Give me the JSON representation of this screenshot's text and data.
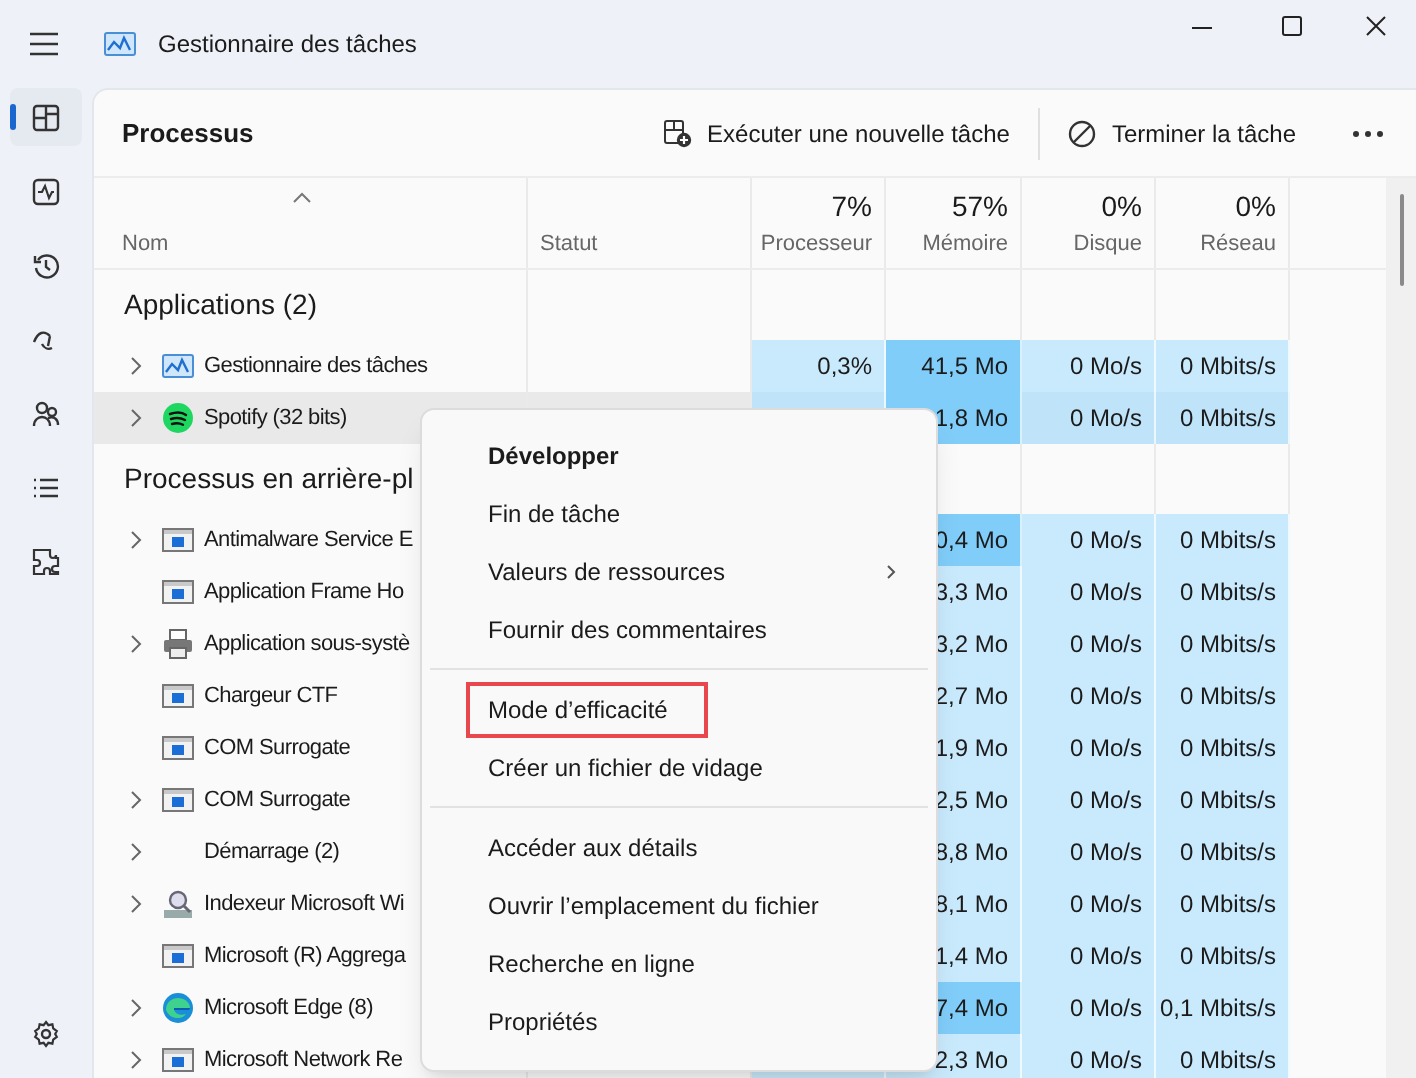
{
  "window": {
    "title": "Gestionnaire des tâches"
  },
  "nav": {
    "items": [
      {
        "selected": true
      },
      {
        "selected": false
      },
      {
        "selected": false
      },
      {
        "selected": false
      },
      {
        "selected": false
      },
      {
        "selected": false
      },
      {
        "selected": false
      }
    ]
  },
  "toolbar": {
    "title": "Processus",
    "actions": [
      {
        "label": "Exécuter une nouvelle tâche"
      },
      {
        "label": "Terminer la tâche"
      }
    ]
  },
  "columns": [
    {
      "label": "Nom",
      "sorted": true
    },
    {
      "label": "Statut",
      "sorted": false
    },
    {
      "label": "Processeur",
      "percent": "7%",
      "sorted": false
    },
    {
      "label": "Mémoire",
      "percent": "57%",
      "sorted": false
    },
    {
      "label": "Disque",
      "percent": "0%",
      "sorted": false
    },
    {
      "label": "Réseau",
      "percent": "0%",
      "sorted": false
    }
  ],
  "groups": [
    {
      "title": "Applications (2)",
      "rows": [
        {
          "name": "Gestionnaire des tâches",
          "kind": "taskmgr",
          "expandable": true,
          "highlighted": false,
          "cells": {
            "cpu": {
              "text": "0,3%",
              "high": false
            },
            "memory": {
              "text": "41,5 Mo",
              "high": true
            },
            "disk": {
              "text": "0 Mo/s",
              "high": false
            },
            "network": {
              "text": "0 Mbits/s",
              "high": false
            }
          }
        },
        {
          "name": "Spotify (32 bits)",
          "kind": "spotify",
          "expandable": true,
          "highlighted": true,
          "cells": {
            "memory": {
              "text": "1,8 Mo",
              "high": true
            },
            "disk": {
              "text": "0 Mo/s",
              "high": false
            },
            "network": {
              "text": "0 Mbits/s",
              "high": false
            }
          }
        }
      ]
    },
    {
      "title": "Processus en arrière-pl",
      "rows": [
        {
          "name": "Antimalware Service E",
          "kind": "app",
          "expandable": true,
          "highlighted": false,
          "cells": {
            "memory": {
              "text": "0,4 Mo",
              "high": true
            },
            "disk": {
              "text": "0 Mo/s",
              "high": false
            },
            "network": {
              "text": "0 Mbits/s",
              "high": false
            }
          }
        },
        {
          "name": "Application Frame Ho",
          "kind": "app",
          "expandable": false,
          "highlighted": false,
          "cells": {
            "memory": {
              "text": "3,3 Mo",
              "high": false
            },
            "disk": {
              "text": "0 Mo/s",
              "high": false
            },
            "network": {
              "text": "0 Mbits/s",
              "high": false
            }
          }
        },
        {
          "name": "Application sous-systè",
          "kind": "printer",
          "expandable": true,
          "highlighted": false,
          "cells": {
            "memory": {
              "text": "3,2 Mo",
              "high": false
            },
            "disk": {
              "text": "0 Mo/s",
              "high": false
            },
            "network": {
              "text": "0 Mbits/s",
              "high": false
            }
          }
        },
        {
          "name": "Chargeur CTF",
          "kind": "app",
          "expandable": false,
          "highlighted": false,
          "cells": {
            "memory": {
              "text": "2,7 Mo",
              "high": false
            },
            "disk": {
              "text": "0 Mo/s",
              "high": false
            },
            "network": {
              "text": "0 Mbits/s",
              "high": false
            }
          }
        },
        {
          "name": "COM Surrogate",
          "kind": "app",
          "expandable": false,
          "highlighted": false,
          "cells": {
            "memory": {
              "text": "1,9 Mo",
              "high": false
            },
            "disk": {
              "text": "0 Mo/s",
              "high": false
            },
            "network": {
              "text": "0 Mbits/s",
              "high": false
            }
          }
        },
        {
          "name": "COM Surrogate",
          "kind": "app",
          "expandable": true,
          "highlighted": false,
          "cells": {
            "memory": {
              "text": "2,5 Mo",
              "high": false
            },
            "disk": {
              "text": "0 Mo/s",
              "high": false
            },
            "network": {
              "text": "0 Mbits/s",
              "high": false
            }
          }
        },
        {
          "name": "Démarrage (2)",
          "kind": "blank",
          "expandable": true,
          "highlighted": false,
          "cells": {
            "memory": {
              "text": "8,8 Mo",
              "high": false
            },
            "disk": {
              "text": "0 Mo/s",
              "high": false
            },
            "network": {
              "text": "0 Mbits/s",
              "high": false
            }
          }
        },
        {
          "name": "Indexeur Microsoft Wi",
          "kind": "indexer",
          "expandable": true,
          "highlighted": false,
          "cells": {
            "memory": {
              "text": "8,1 Mo",
              "high": false
            },
            "disk": {
              "text": "0 Mo/s",
              "high": false
            },
            "network": {
              "text": "0 Mbits/s",
              "high": false
            }
          }
        },
        {
          "name": "Microsoft (R) Aggrega",
          "kind": "app",
          "expandable": false,
          "highlighted": false,
          "cells": {
            "memory": {
              "text": "1,4 Mo",
              "high": false
            },
            "disk": {
              "text": "0 Mo/s",
              "high": false
            },
            "network": {
              "text": "0 Mbits/s",
              "high": false
            }
          }
        },
        {
          "name": "Microsoft Edge (8)",
          "kind": "edge",
          "expandable": true,
          "highlighted": false,
          "cells": {
            "memory": {
              "text": "7,4 Mo",
              "high": true
            },
            "disk": {
              "text": "0 Mo/s",
              "high": false
            },
            "network": {
              "text": "0,1 Mbits/s",
              "high": false
            }
          }
        },
        {
          "name": "Microsoft Network Re",
          "kind": "app",
          "expandable": true,
          "highlighted": false,
          "cells": {
            "memory": {
              "text": "2,3 Mo",
              "high": false
            },
            "disk": {
              "text": "0 Mo/s",
              "high": false
            },
            "network": {
              "text": "0 Mbits/s",
              "high": false
            }
          }
        }
      ]
    }
  ],
  "context_menu": {
    "items": [
      {
        "kind": "item",
        "label": "Développer",
        "bold": true,
        "submenu": false,
        "annotated": false
      },
      {
        "kind": "item",
        "label": "Fin de tâche",
        "bold": false,
        "submenu": false,
        "annotated": false
      },
      {
        "kind": "item",
        "label": "Valeurs de ressources",
        "bold": false,
        "submenu": true,
        "annotated": false
      },
      {
        "kind": "item",
        "label": "Fournir des commentaires",
        "bold": false,
        "submenu": false,
        "annotated": false
      },
      {
        "kind": "separator"
      },
      {
        "kind": "item",
        "label": "Mode d’efficacité",
        "bold": false,
        "submenu": false,
        "annotated": true
      },
      {
        "kind": "item",
        "label": "Créer un fichier de vidage",
        "bold": false,
        "submenu": false,
        "annotated": false
      },
      {
        "kind": "separator"
      },
      {
        "kind": "item",
        "label": "Accéder aux détails",
        "bold": false,
        "submenu": false,
        "annotated": false
      },
      {
        "kind": "item",
        "label": "Ouvrir l’emplacement du fichier",
        "bold": false,
        "submenu": false,
        "annotated": false
      },
      {
        "kind": "item",
        "label": "Recherche en ligne",
        "bold": false,
        "submenu": false,
        "annotated": false
      },
      {
        "kind": "item",
        "label": "Propriétés",
        "bold": false,
        "submenu": false,
        "annotated": false
      }
    ]
  }
}
